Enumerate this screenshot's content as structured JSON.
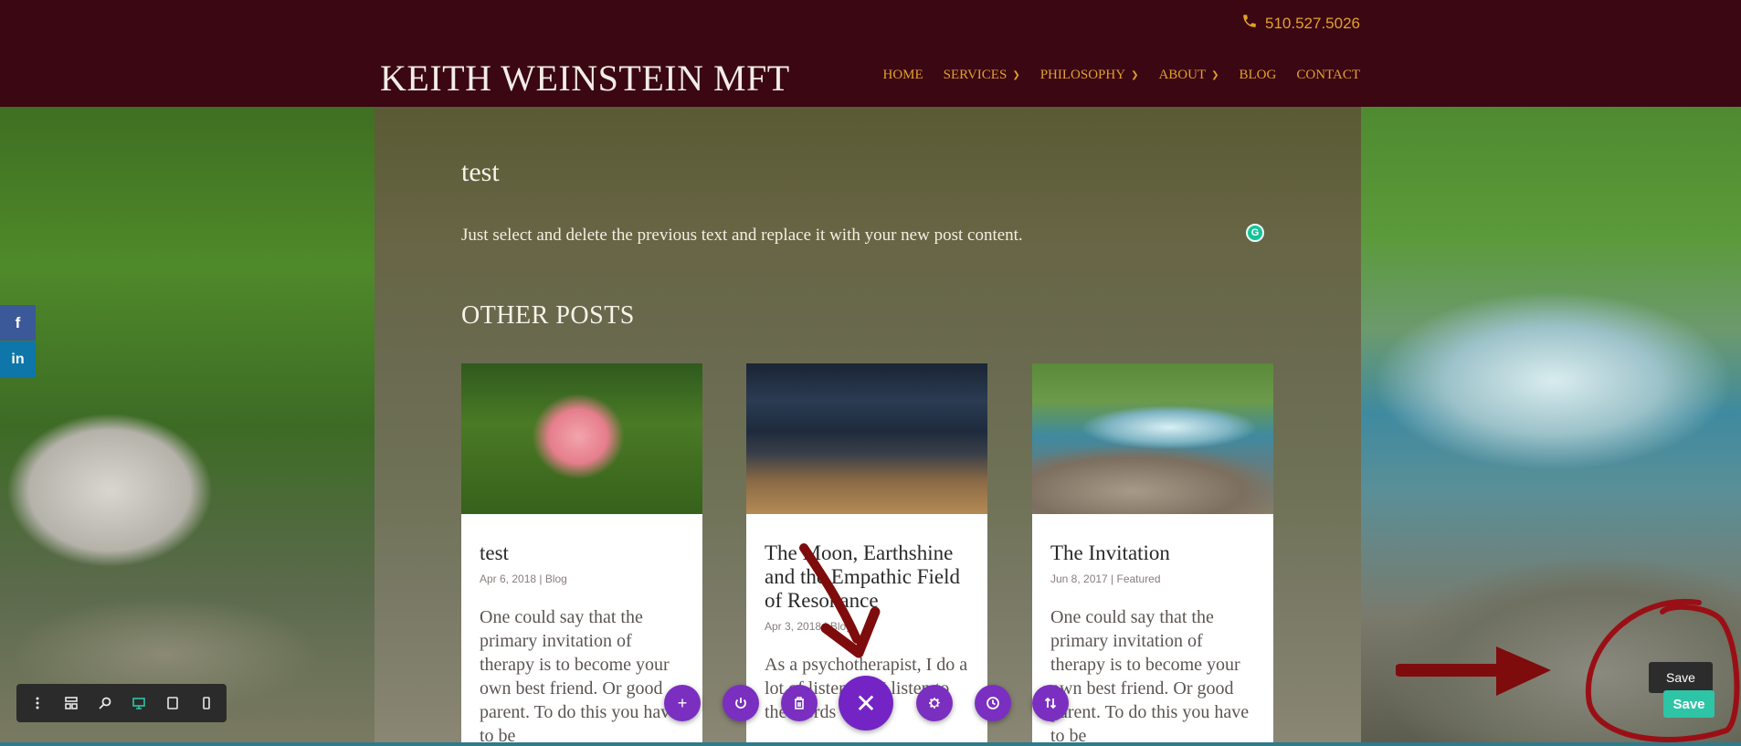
{
  "header": {
    "phone": "510.527.5026",
    "site_title": "KEITH WEINSTEIN MFT",
    "nav": [
      {
        "label": "HOME",
        "dropdown": false
      },
      {
        "label": "SERVICES",
        "dropdown": true
      },
      {
        "label": "PHILOSOPHY",
        "dropdown": true
      },
      {
        "label": "ABOUT",
        "dropdown": true
      },
      {
        "label": "BLOG",
        "dropdown": false
      },
      {
        "label": "CONTACT",
        "dropdown": false
      }
    ]
  },
  "post": {
    "title": "test",
    "body": "Just select and delete the previous text and replace it with your new post content.",
    "grammarly_badge": "G"
  },
  "other_posts": {
    "heading": "OTHER POSTS",
    "cards": [
      {
        "title": "test",
        "meta": "Apr 6, 2018 | Blog",
        "excerpt": "One could say that the primary invitation of therapy is to become your own best friend. Or good parent. To do this you have to be",
        "image": "pink-poppy-flower"
      },
      {
        "title": "The Moon, Earthshine and the Empathic Field of Resonance",
        "meta": "Apr 3, 2018 | Blog",
        "excerpt": "As a psychotherapist, I do a lot of listening. I listen to the words of my",
        "image": "moon-sky"
      },
      {
        "title": "The Invitation",
        "meta": "Jun 8, 2017 | Featured",
        "excerpt": "One could say that the primary invitation of therapy is to become your own best friend. Or good parent. To do this you have to be",
        "image": "river-rocks"
      }
    ]
  },
  "social": {
    "facebook": "f",
    "linkedin": "in"
  },
  "builder": {
    "toolbar": [
      "menu-icon",
      "wireframe-icon",
      "zoom-icon",
      "desktop-icon",
      "tablet-icon",
      "phone-icon"
    ],
    "fabs": [
      "+",
      "power-icon",
      "trash-icon",
      "✕",
      "gear-icon",
      "history-icon",
      "sort-icon"
    ],
    "save_tooltip": "Save",
    "save_button": "Save"
  },
  "colors": {
    "header_bg": "#3a0713",
    "accent": "#e3a02a",
    "builder_purple": "#7b2fc0",
    "save_green": "#2ec4a6"
  }
}
